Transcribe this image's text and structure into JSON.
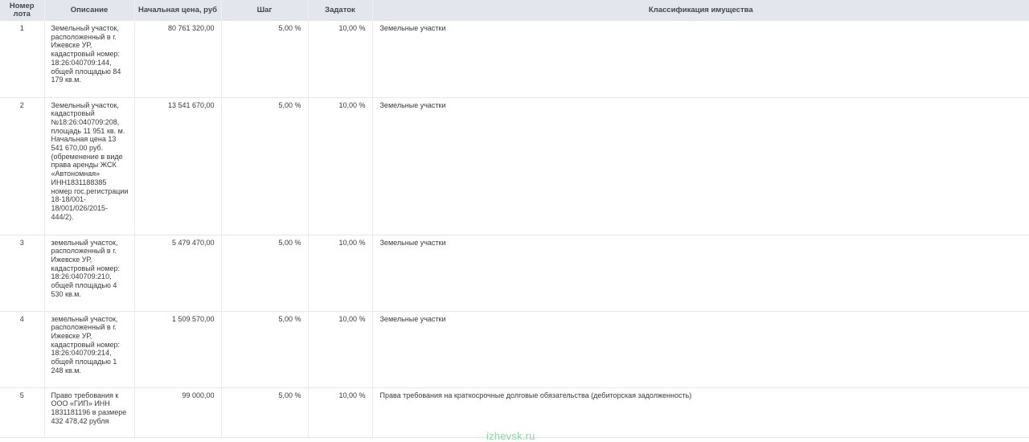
{
  "table": {
    "headers": {
      "lot_number": "Номер лота",
      "description": "Описание",
      "start_price": "Начальная цена, руб",
      "step": "Шаг",
      "deposit": "Задаток",
      "classification": "Классификация имущества"
    },
    "rows": [
      {
        "lot_number": "1",
        "description": "Земельный участок, расположенный в г. Ижевске УР, кадастровый номер: 18:26:040709:144, общей площадью 84 179 кв.м.",
        "start_price": "80 761 320,00",
        "step": "5,00 %",
        "deposit": "10,00 %",
        "classification": "Земельные участки"
      },
      {
        "lot_number": "2",
        "description": "Земельный участок, кадастровый №18:26:040709:208, площадь 11 951 кв. м. Начальная цена 13 541 670,00 руб. (обременение в виде права аренды ЖСК «Автономная» ИНН1831188385 номер гос.регистрации 18-18/001-18/001/026/2015-444/2).",
        "start_price": "13 541 670,00",
        "step": "5,00 %",
        "deposit": "10,00 %",
        "classification": "Земельные участки"
      },
      {
        "lot_number": "3",
        "description": "земельный участок, расположенный в г. Ижевске УР, кадастровый номер: 18:26:040709:210, общей площадью 4 530 кв.м.",
        "start_price": "5 479 470,00",
        "step": "5,00 %",
        "deposit": "10,00 %",
        "classification": "Земельные участки"
      },
      {
        "lot_number": "4",
        "description": "земельный участок, расположенный в г. Ижевске УР, кадастровый номер: 18:26:040709:214, общей площадью 1 248 кв.м.",
        "start_price": "1 509 570,00",
        "step": "5,00 %",
        "deposit": "10,00 %",
        "classification": "Земельные участки"
      },
      {
        "lot_number": "5",
        "description": "Право требования к ООО «ГИП» ИНН 1831181196 в размере 432 478,42 рубля",
        "start_price": "99 000,00",
        "step": "5,00 %",
        "deposit": "10,00 %",
        "classification": "Права требования на краткосрочные долговые обязательства (дебиторская задолженность)"
      }
    ]
  },
  "watermark": "izhevsk.ru",
  "colors": {
    "header_background": "#e3e6ec",
    "watermark": "#8fd4a8"
  }
}
